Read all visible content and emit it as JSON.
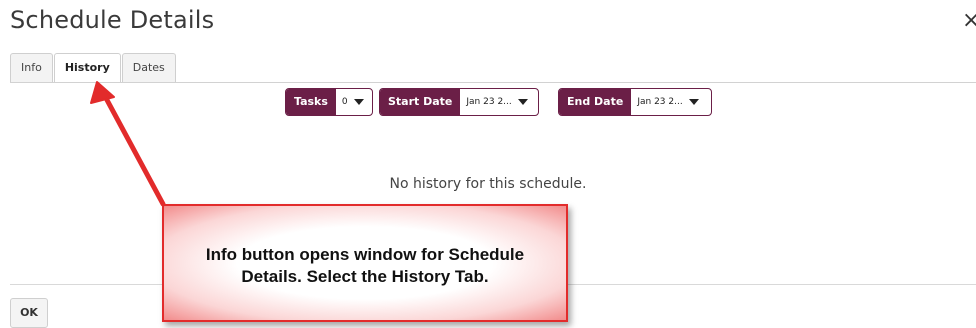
{
  "dialog": {
    "title": "Schedule Details",
    "close_glyph": "×"
  },
  "tabs": [
    {
      "label": "Info",
      "active": false
    },
    {
      "label": "History",
      "active": true
    },
    {
      "label": "Dates",
      "active": false
    }
  ],
  "filters": {
    "tasks": {
      "label": "Tasks",
      "value": "0"
    },
    "start_date": {
      "label": "Start Date",
      "value": "Jan 23 2..."
    },
    "end_date": {
      "label": "End Date",
      "value": "Jan 23 2..."
    }
  },
  "history": {
    "empty_message": "No history for this schedule."
  },
  "footer": {
    "ok_label": "OK"
  },
  "annotation": {
    "text": "Info button opens window for Schedule Details.  Select the History Tab.",
    "border_color": "#e22b2b"
  },
  "colors": {
    "accent": "#6b1f47"
  }
}
